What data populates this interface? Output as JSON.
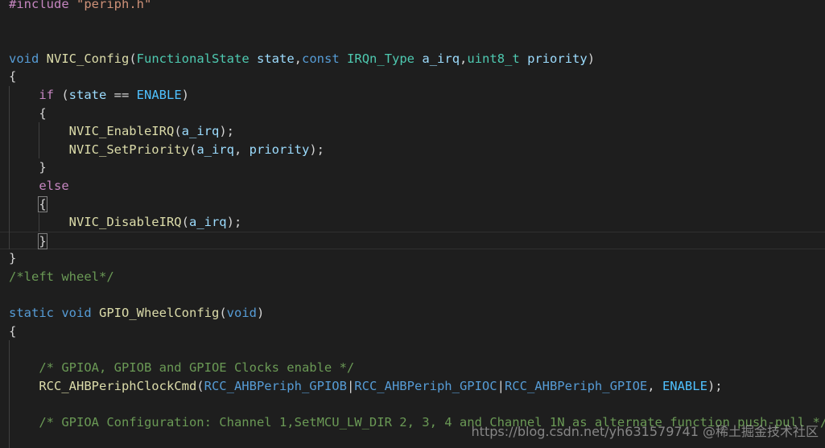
{
  "editor": {
    "background": "#1e1e1e",
    "lines": [
      {
        "tokens": [
          {
            "t": "#include ",
            "c": "#c586c0"
          },
          {
            "t": "\"periph.h\"",
            "c": "#ce9178"
          }
        ]
      },
      {
        "tokens": []
      },
      {
        "tokens": []
      },
      {
        "tokens": [
          {
            "t": "void",
            "c": "#569cd6"
          },
          {
            "t": " ",
            "c": "#d4d4d4"
          },
          {
            "t": "NVIC_Config",
            "c": "#dcdcaa"
          },
          {
            "t": "(",
            "c": "#d4d4d4"
          },
          {
            "t": "FunctionalState",
            "c": "#4ec9b0"
          },
          {
            "t": " ",
            "c": "#d4d4d4"
          },
          {
            "t": "state",
            "c": "#9cdcfe"
          },
          {
            "t": ",",
            "c": "#d4d4d4"
          },
          {
            "t": "const",
            "c": "#569cd6"
          },
          {
            "t": " ",
            "c": "#d4d4d4"
          },
          {
            "t": "IRQn_Type",
            "c": "#4ec9b0"
          },
          {
            "t": " ",
            "c": "#d4d4d4"
          },
          {
            "t": "a_irq",
            "c": "#9cdcfe"
          },
          {
            "t": ",",
            "c": "#d4d4d4"
          },
          {
            "t": "uint8_t",
            "c": "#4ec9b0"
          },
          {
            "t": " ",
            "c": "#d4d4d4"
          },
          {
            "t": "priority",
            "c": "#9cdcfe"
          },
          {
            "t": ")",
            "c": "#d4d4d4"
          }
        ]
      },
      {
        "tokens": [
          {
            "t": "{",
            "c": "#d4d4d4"
          }
        ]
      },
      {
        "tokens": [
          {
            "t": "    ",
            "c": "#d4d4d4"
          },
          {
            "t": "if",
            "c": "#c586c0"
          },
          {
            "t": " (",
            "c": "#d4d4d4"
          },
          {
            "t": "state",
            "c": "#9cdcfe"
          },
          {
            "t": " == ",
            "c": "#d4d4d4"
          },
          {
            "t": "ENABLE",
            "c": "#4fc1ff"
          },
          {
            "t": ")",
            "c": "#d4d4d4"
          }
        ]
      },
      {
        "tokens": [
          {
            "t": "    {",
            "c": "#d4d4d4"
          }
        ]
      },
      {
        "tokens": [
          {
            "t": "        ",
            "c": "#d4d4d4"
          },
          {
            "t": "NVIC_EnableIRQ",
            "c": "#dcdcaa"
          },
          {
            "t": "(",
            "c": "#d4d4d4"
          },
          {
            "t": "a_irq",
            "c": "#9cdcfe"
          },
          {
            "t": ");",
            "c": "#d4d4d4"
          }
        ]
      },
      {
        "tokens": [
          {
            "t": "        ",
            "c": "#d4d4d4"
          },
          {
            "t": "NVIC_SetPriority",
            "c": "#dcdcaa"
          },
          {
            "t": "(",
            "c": "#d4d4d4"
          },
          {
            "t": "a_irq",
            "c": "#9cdcfe"
          },
          {
            "t": ", ",
            "c": "#d4d4d4"
          },
          {
            "t": "priority",
            "c": "#9cdcfe"
          },
          {
            "t": ");",
            "c": "#d4d4d4"
          }
        ]
      },
      {
        "tokens": [
          {
            "t": "    }",
            "c": "#d4d4d4"
          }
        ]
      },
      {
        "tokens": [
          {
            "t": "    ",
            "c": "#d4d4d4"
          },
          {
            "t": "else",
            "c": "#c586c0"
          }
        ]
      },
      {
        "tokens": [
          {
            "t": "    ",
            "c": "#d4d4d4"
          },
          {
            "t": "{",
            "c": "#d4d4d4",
            "box": true
          }
        ]
      },
      {
        "tokens": [
          {
            "t": "        ",
            "c": "#d4d4d4"
          },
          {
            "t": "NVIC_DisableIRQ",
            "c": "#dcdcaa"
          },
          {
            "t": "(",
            "c": "#d4d4d4"
          },
          {
            "t": "a_irq",
            "c": "#9cdcfe"
          },
          {
            "t": ");",
            "c": "#d4d4d4"
          }
        ]
      },
      {
        "tokens": [
          {
            "t": "    ",
            "c": "#d4d4d4"
          },
          {
            "t": "}",
            "c": "#d4d4d4",
            "box": true
          }
        ],
        "current": true
      },
      {
        "tokens": [
          {
            "t": "}",
            "c": "#d4d4d4"
          }
        ]
      },
      {
        "tokens": [
          {
            "t": "/*left wheel*/",
            "c": "#6a9955"
          }
        ]
      },
      {
        "tokens": []
      },
      {
        "tokens": [
          {
            "t": "static",
            "c": "#569cd6"
          },
          {
            "t": " ",
            "c": "#d4d4d4"
          },
          {
            "t": "void",
            "c": "#569cd6"
          },
          {
            "t": " ",
            "c": "#d4d4d4"
          },
          {
            "t": "GPIO_WheelConfig",
            "c": "#dcdcaa"
          },
          {
            "t": "(",
            "c": "#d4d4d4"
          },
          {
            "t": "void",
            "c": "#569cd6"
          },
          {
            "t": ")",
            "c": "#d4d4d4"
          }
        ]
      },
      {
        "tokens": [
          {
            "t": "{",
            "c": "#d4d4d4"
          }
        ]
      },
      {
        "tokens": []
      },
      {
        "tokens": [
          {
            "t": "    ",
            "c": "#d4d4d4"
          },
          {
            "t": "/* GPIOA, GPIOB and GPIOE Clocks enable */",
            "c": "#6a9955"
          }
        ]
      },
      {
        "tokens": [
          {
            "t": "    ",
            "c": "#d4d4d4"
          },
          {
            "t": "RCC_AHBPeriphClockCmd",
            "c": "#dcdcaa"
          },
          {
            "t": "(",
            "c": "#d4d4d4"
          },
          {
            "t": "RCC_AHBPeriph_GPIOB",
            "c": "#569cd6"
          },
          {
            "t": "|",
            "c": "#d4d4d4"
          },
          {
            "t": "RCC_AHBPeriph_GPIOC",
            "c": "#569cd6"
          },
          {
            "t": "|",
            "c": "#d4d4d4"
          },
          {
            "t": "RCC_AHBPeriph_GPIOE",
            "c": "#569cd6"
          },
          {
            "t": ", ",
            "c": "#d4d4d4"
          },
          {
            "t": "ENABLE",
            "c": "#4fc1ff"
          },
          {
            "t": ");",
            "c": "#d4d4d4"
          }
        ]
      },
      {
        "tokens": []
      },
      {
        "tokens": [
          {
            "t": "    ",
            "c": "#d4d4d4"
          },
          {
            "t": "/* GPIOA Configuration: Channel 1,SetMCU_LW_DIR 2, 3, 4 and Channel 1N as alternate function push-pull */",
            "c": "#6a9955"
          }
        ]
      },
      {
        "tokens": []
      }
    ]
  },
  "watermark": {
    "text": "https://blog.csdn.net/yh631579741 @稀土掘金技术社区"
  }
}
